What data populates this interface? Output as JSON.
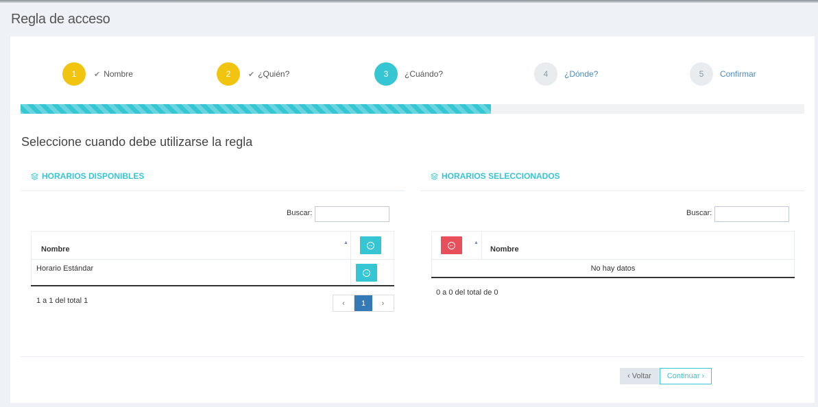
{
  "page": {
    "title": "Regla de acceso"
  },
  "wizard": {
    "steps": [
      {
        "num": "1",
        "label": "Nombre",
        "state": "done"
      },
      {
        "num": "2",
        "label": "¿Quién?",
        "state": "done"
      },
      {
        "num": "3",
        "label": "¿Cuándo?",
        "state": "active"
      },
      {
        "num": "4",
        "label": "¿Dónde?",
        "state": "todo"
      },
      {
        "num": "5",
        "label": "Confirmar",
        "state": "todo"
      }
    ],
    "progress": 0.6
  },
  "subtitle": "Seleccione cuando debe utilizarse la regla",
  "available": {
    "title": "HORARIOS DISPONIBLES",
    "search_label": "Buscar:",
    "search_value": "",
    "column": "Nombre",
    "rows": [
      {
        "name": "Horario Estándar"
      }
    ],
    "info": "1 a 1 del total 1",
    "pager": {
      "prev": "‹",
      "current": "1",
      "next": "›"
    }
  },
  "selected": {
    "title": "HORARIOS SELECCIONADOS",
    "search_label": "Buscar:",
    "search_value": "",
    "column": "Nombre",
    "empty": "No hay datos",
    "info": "0 a 0 del total de 0"
  },
  "footer": {
    "back": "‹ Voltar",
    "next": "Continuar ›"
  },
  "colors": {
    "accent": "#36c6d3",
    "done": "#f1c40f",
    "danger": "#e7505a",
    "pager_active": "#337ab7"
  }
}
